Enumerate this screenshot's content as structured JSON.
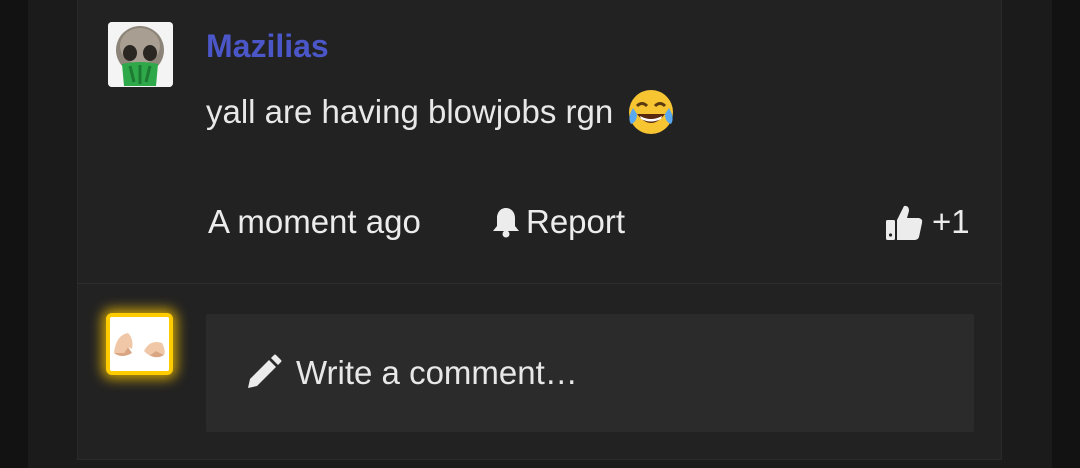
{
  "comment": {
    "author": "Mazilias",
    "text": "yall are having blowjobs rgn",
    "emoji_icon": "face-with-tears-of-joy-icon",
    "timestamp": "A moment ago",
    "report_label": "Report",
    "like_count": "+1",
    "author_name_color": "#4b57c9"
  },
  "composer": {
    "placeholder": "Write a comment…",
    "avatar_highlight_color": "#ffcc00"
  }
}
